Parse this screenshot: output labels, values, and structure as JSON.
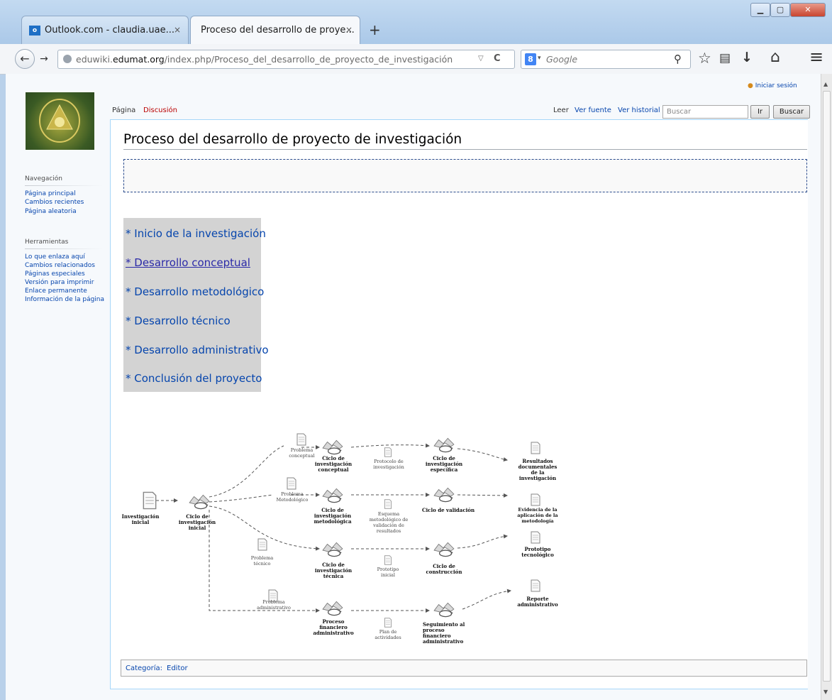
{
  "browser": {
    "tabs": [
      {
        "label": "Outlook.com - claudia.uae...",
        "close": "×"
      },
      {
        "label": "Proceso del desarrollo de proye...",
        "close": "×"
      }
    ],
    "new_tab": "+",
    "window_buttons": {
      "minimize": "▁",
      "maximize": "▢",
      "close": "✕"
    },
    "url": {
      "host": "eduwiki.",
      "domain": "edumat.org",
      "path": "/index.php/Proceso_del_desarrollo_de_proyecto_de_investigación"
    },
    "search": {
      "engine_letter": "8",
      "placeholder": "Google",
      "dropdown": "▾"
    },
    "icons": {
      "back": "←",
      "forward": "→",
      "reload": "C",
      "bookmark": "☆",
      "reader": "▤",
      "download": "↓",
      "home": "⌂",
      "menu": "≡",
      "search": "⚲"
    }
  },
  "wiki": {
    "login": "Iniciar sesión",
    "tabs_left": {
      "page": "Página",
      "discussion": "Discusión"
    },
    "tabs_right": {
      "read": "Leer",
      "view_source": "Ver fuente",
      "history": "Ver historial"
    },
    "search": {
      "placeholder": "Buscar",
      "go": "Ir",
      "search": "Buscar"
    },
    "sidebar": {
      "nav_heading": "Navegación",
      "nav": [
        "Página principal",
        "Cambios recientes",
        "Página aleatoria"
      ],
      "tools_heading": "Herramientas",
      "tools": [
        "Lo que enlaza aquí",
        "Cambios relacionados",
        "Páginas especiales",
        "Versión para imprimir",
        "Enlace permanente",
        "Información de la página"
      ]
    },
    "title": "Proceso del desarrollo de proyecto de investigación",
    "links": [
      "* Inicio de la investigación",
      "* Desarrollo conceptual",
      "* Desarrollo metodológico",
      "* Desarrollo técnico",
      "* Desarrollo administrativo",
      "* Conclusión del proyecto"
    ],
    "category": {
      "label": "Categoría:",
      "value": "Editor"
    }
  },
  "diagram": {
    "start_doc": "Investigación inicial",
    "start_cycle": [
      "Ciclo de",
      "investigación",
      "inicial"
    ],
    "problems": {
      "conceptual": [
        "Problema",
        "conceptual"
      ],
      "metodologico": [
        "Problema",
        "Metodológico"
      ],
      "tecnico": [
        "Problema",
        "técnico"
      ],
      "administrativo": [
        "Problema",
        "administrativo"
      ]
    },
    "cycles": {
      "conceptual": [
        "Ciclo de",
        "investigación",
        "conceptual"
      ],
      "metodologica": [
        "Ciclo de",
        "investigación",
        "metodológica"
      ],
      "tecnica": [
        "Ciclo de",
        "investigación",
        "técnica"
      ],
      "financiero": [
        "Proceso",
        "financiero",
        "administrativo"
      ],
      "especifica": [
        "Ciclo de",
        "investigación",
        "específica"
      ],
      "validacion": [
        "Ciclo de validación"
      ],
      "construccion": [
        "Ciclo de",
        "construcción"
      ],
      "seguimiento": [
        "Seguimiento al",
        "proceso",
        "financiero",
        "administrativo"
      ]
    },
    "docs": {
      "protocolo": [
        "Protocolo de",
        "investigación"
      ],
      "esquema": [
        "Esquema",
        "metodológico de",
        "validación de",
        "resultados"
      ],
      "prototipo": [
        "Prototipo",
        "inicial"
      ],
      "plan": [
        "Plan de",
        "actividades"
      ]
    },
    "outputs": {
      "resultados": [
        "Resultados",
        "documentales",
        "de la",
        "investigación"
      ],
      "evidencia": [
        "Evidencia de la",
        "aplicación de la",
        "metodología"
      ],
      "prototipo_tec": [
        "Prototipo",
        "tecnológico"
      ],
      "reporte": [
        "Reporte",
        "administrativo"
      ]
    }
  }
}
